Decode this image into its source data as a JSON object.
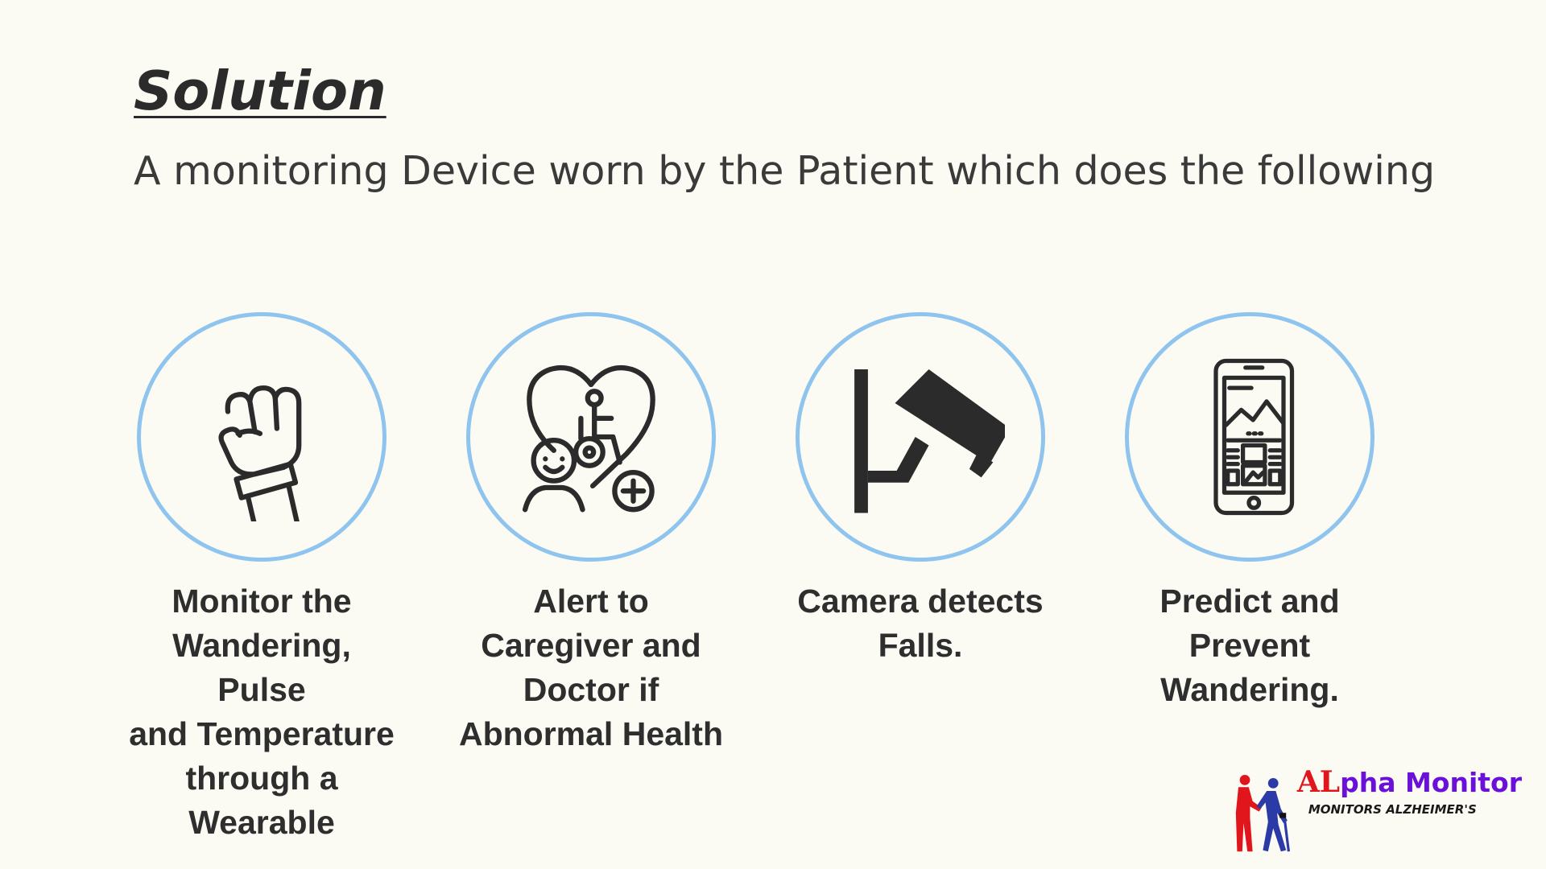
{
  "slide": {
    "title": "Solution",
    "subtitle": "A monitoring Device worn by the Patient which does the following"
  },
  "features": [
    {
      "icon": "raised-fist-wristband-icon",
      "caption_lines": [
        "Monitor the",
        "Wandering, Pulse",
        "and Temperature",
        "through a",
        "Wearable"
      ]
    },
    {
      "icon": "heart-wheelchair-plus-icon",
      "caption_lines": [
        "Alert to",
        "Caregiver and",
        "Doctor if",
        "Abnormal Health"
      ]
    },
    {
      "icon": "security-camera-icon",
      "caption_lines": [
        "Camera detects",
        "Falls."
      ]
    },
    {
      "icon": "smartphone-app-icon",
      "caption_lines": [
        "Predict and",
        "Prevent",
        "Wandering."
      ]
    }
  ],
  "logo": {
    "name_prefix": "AL",
    "name_rest": "pha Monitor",
    "tagline": "MONITORS ALZHEIMER'S"
  },
  "colors": {
    "background": "#fbfbf3",
    "circle_border": "#8ec4ee",
    "text": "#333333",
    "logo_red": "#e0161c",
    "logo_purple": "#6a10d8",
    "logo_blue": "#2c3aa8"
  }
}
